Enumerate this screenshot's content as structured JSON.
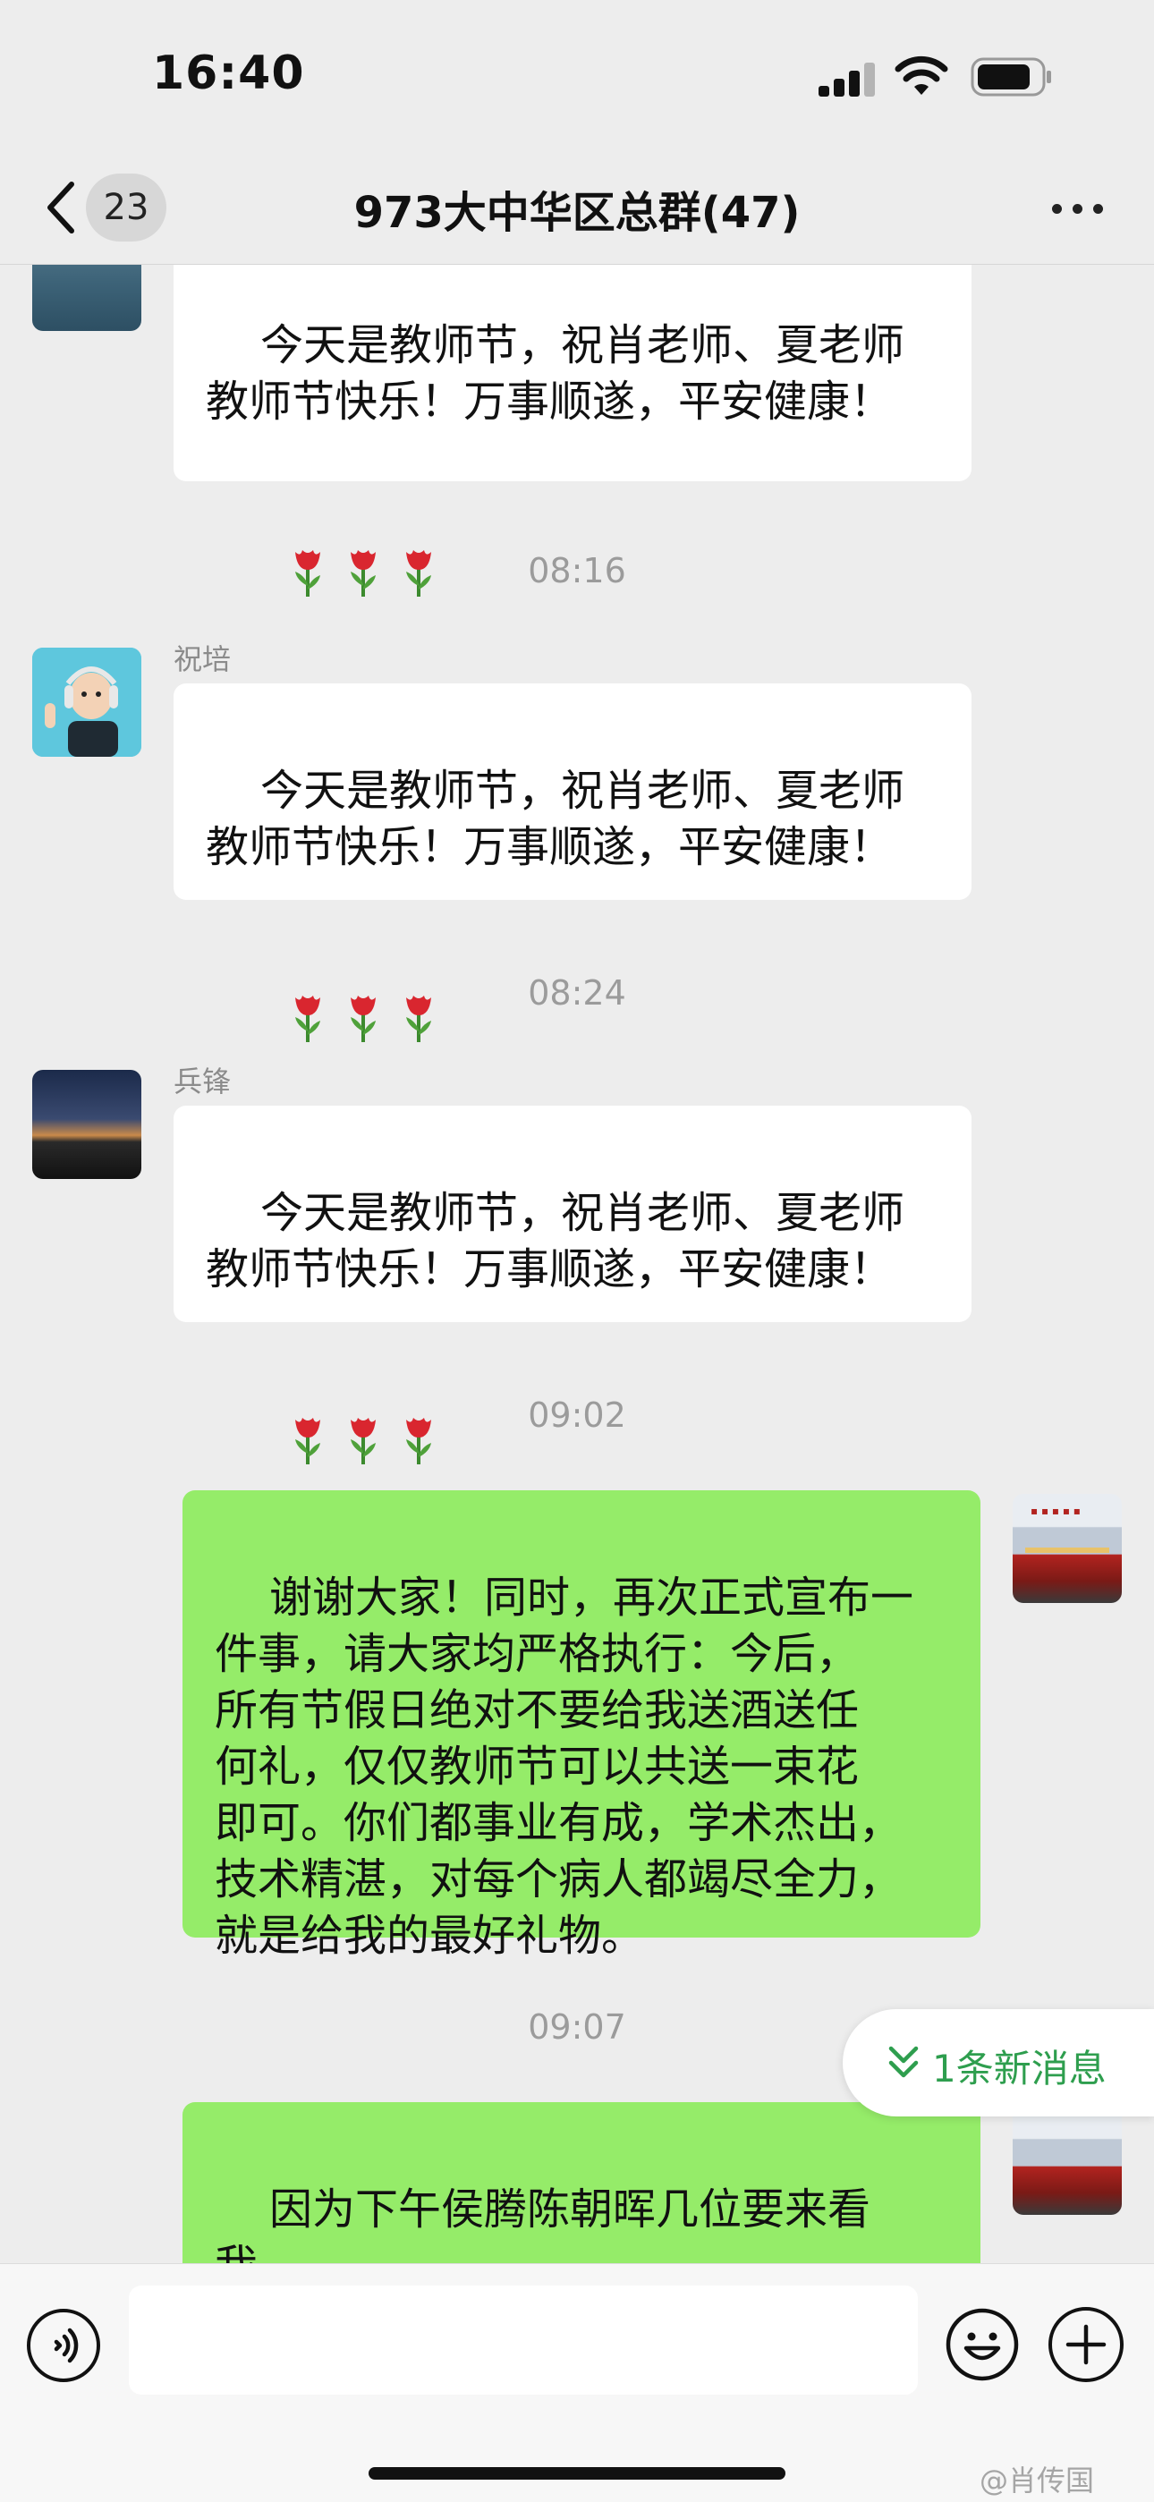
{
  "status_bar": {
    "time": "16:40"
  },
  "nav": {
    "back_badge": "23",
    "title": "973大中华区总群(47)"
  },
  "messages": [
    {
      "text": "今天是教师节，祝肖老师、夏老师\n教师节快乐！万事顺遂，平安健康！"
    },
    {
      "timestamp": "08:16",
      "sender": "祝培",
      "text": "今天是教师节，祝肖老师、夏老师\n教师节快乐！万事顺遂，平安健康！"
    },
    {
      "timestamp": "08:24",
      "sender": "兵锋",
      "text": "今天是教师节，祝肖老师、夏老师\n教师节快乐！万事顺遂，平安健康！"
    },
    {
      "timestamp": "09:02",
      "text": "谢谢大家！同时，再次正式宣布一\n件事，请大家均严格执行：今后，\n所有节假日绝对不要给我送酒送任\n何礼，仅仅教师节可以共送一束花\n即可。你们都事业有成，学术杰出，\n技术精湛，对每个病人都竭尽全力，\n就是给我的最好礼物。"
    },
    {
      "timestamp": "09:07",
      "text": "因为下午侯腾陈朝晖几位要来看我，\n特此提前打预防针。"
    }
  ],
  "new_messages_label": "1条新消息",
  "input": {
    "placeholder": ""
  },
  "watermark": "@肖传国",
  "colors": {
    "background": "#ededed",
    "incoming_bubble": "#ffffff",
    "outgoing_bubble": "#95ec69",
    "accent_green": "#2e9e4e"
  },
  "icons": [
    "back-chevron-icon",
    "more-icon",
    "tulip-icon",
    "double-chevron-down-icon",
    "voice-icon",
    "emoji-icon",
    "plus-icon"
  ]
}
